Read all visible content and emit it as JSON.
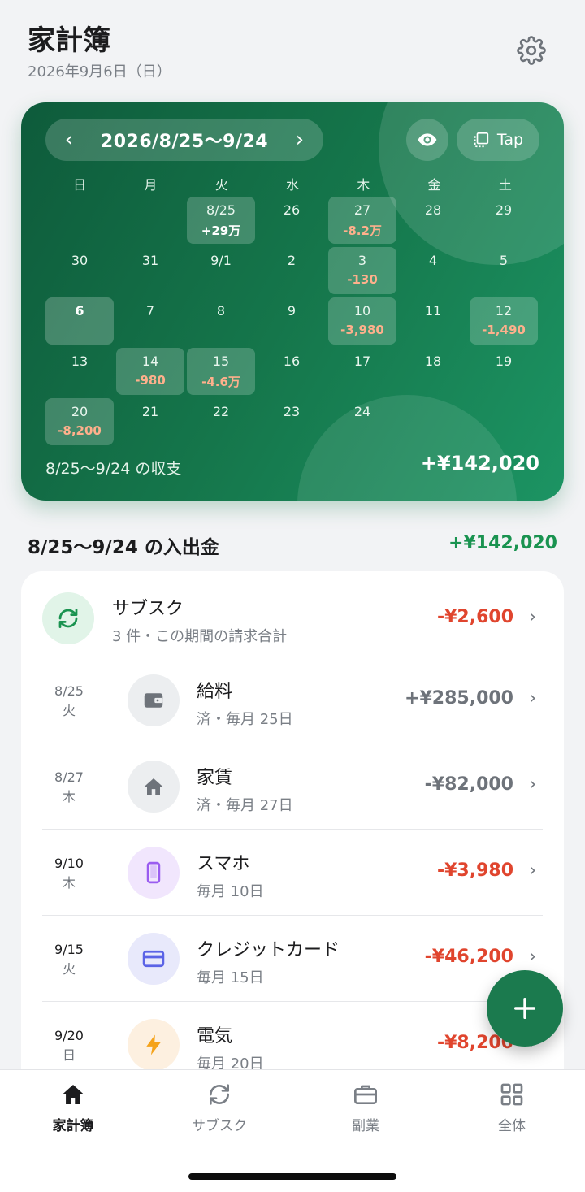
{
  "header": {
    "title": "家計簿",
    "date": "2026年9月6日（日）"
  },
  "card": {
    "range": "2026/8/25〜9/24",
    "tap_label": "Tap",
    "weekdays": [
      "日",
      "月",
      "火",
      "水",
      "木",
      "金",
      "土"
    ],
    "cells": [
      {
        "d": "",
        "a": "",
        "t": ""
      },
      {
        "d": "",
        "a": "",
        "t": ""
      },
      {
        "d": "8/25",
        "a": "+29万",
        "t": "pos",
        "hl": true
      },
      {
        "d": "26",
        "a": "",
        "t": ""
      },
      {
        "d": "27",
        "a": "-8.2万",
        "t": "neg",
        "hl": true
      },
      {
        "d": "28",
        "a": "",
        "t": ""
      },
      {
        "d": "29",
        "a": "",
        "t": ""
      },
      {
        "d": "30",
        "a": "",
        "t": ""
      },
      {
        "d": "31",
        "a": "",
        "t": ""
      },
      {
        "d": "9/1",
        "a": "",
        "t": ""
      },
      {
        "d": "2",
        "a": "",
        "t": ""
      },
      {
        "d": "3",
        "a": "-130",
        "t": "neg",
        "hl": true
      },
      {
        "d": "4",
        "a": "",
        "t": ""
      },
      {
        "d": "5",
        "a": "",
        "t": ""
      },
      {
        "d": "6",
        "a": "",
        "t": "",
        "today": true
      },
      {
        "d": "7",
        "a": "",
        "t": ""
      },
      {
        "d": "8",
        "a": "",
        "t": ""
      },
      {
        "d": "9",
        "a": "",
        "t": ""
      },
      {
        "d": "10",
        "a": "-3,980",
        "t": "neg",
        "hl": true
      },
      {
        "d": "11",
        "a": "",
        "t": ""
      },
      {
        "d": "12",
        "a": "-1,490",
        "t": "neg",
        "hl": true
      },
      {
        "d": "13",
        "a": "",
        "t": ""
      },
      {
        "d": "14",
        "a": "-980",
        "t": "neg",
        "hl": true
      },
      {
        "d": "15",
        "a": "-4.6万",
        "t": "neg",
        "hl": true
      },
      {
        "d": "16",
        "a": "",
        "t": ""
      },
      {
        "d": "17",
        "a": "",
        "t": ""
      },
      {
        "d": "18",
        "a": "",
        "t": ""
      },
      {
        "d": "19",
        "a": "",
        "t": ""
      },
      {
        "d": "20",
        "a": "-8,200",
        "t": "neg",
        "hl": true
      },
      {
        "d": "21",
        "a": "",
        "t": ""
      },
      {
        "d": "22",
        "a": "",
        "t": ""
      },
      {
        "d": "23",
        "a": "",
        "t": ""
      },
      {
        "d": "24",
        "a": "",
        "t": ""
      }
    ],
    "summary_label": "8/25〜9/24 の収支",
    "summary_total": "+¥142,020"
  },
  "section": {
    "title": "8/25〜9/24 の入出金",
    "total": "+¥142,020"
  },
  "list": [
    {
      "date": "",
      "dow": "",
      "name": "サブスク",
      "sub": "3 件・この期間の請求合計",
      "amount": "-¥2,600",
      "tone": "red",
      "icon": "refresh-icon",
      "icbg": "#e1f4e8",
      "iccolor": "#1a9350"
    },
    {
      "date": "8/25",
      "dow": "火",
      "name": "給料",
      "sub": "済・毎月 25日",
      "amount": "+¥285,000",
      "tone": "gray",
      "icon": "wallet-icon",
      "icbg": "#eceef0",
      "iccolor": "#6e737a"
    },
    {
      "date": "8/27",
      "dow": "木",
      "name": "家賃",
      "sub": "済・毎月 27日",
      "amount": "-¥82,000",
      "tone": "gray",
      "icon": "home-icon",
      "icbg": "#eceef0",
      "iccolor": "#6e737a"
    },
    {
      "date": "9/10",
      "dow": "木",
      "name": "スマホ",
      "sub": "毎月 10日",
      "amount": "-¥3,980",
      "tone": "red",
      "icon": "phone-icon",
      "icbg": "#f1e6fd",
      "iccolor": "#9a5cf0"
    },
    {
      "date": "9/15",
      "dow": "火",
      "name": "クレジットカード",
      "sub": "毎月 15日",
      "amount": "-¥46,200",
      "tone": "red",
      "icon": "card-icon",
      "icbg": "#e8e9fb",
      "iccolor": "#5b63e6"
    },
    {
      "date": "9/20",
      "dow": "日",
      "name": "電気",
      "sub": "毎月 20日",
      "amount": "-¥8,200",
      "tone": "red",
      "icon": "bolt-icon",
      "icbg": "#fdf0e0",
      "iccolor": "#f5a31a"
    }
  ],
  "tabs": [
    "家計簿",
    "サブスク",
    "副業",
    "全体"
  ]
}
